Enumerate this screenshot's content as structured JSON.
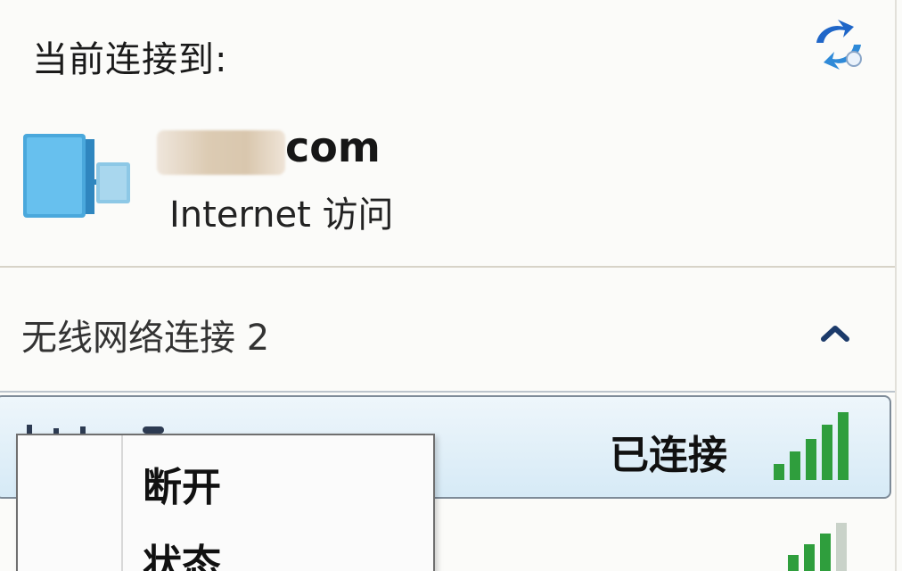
{
  "header": {
    "title": "当前连接到:"
  },
  "current_network": {
    "name_visible_suffix": "com",
    "access": "Internet 访问"
  },
  "wireless_section": {
    "title": "无线网络连接 2"
  },
  "network_list": {
    "selected_status": "已连接"
  },
  "context_menu": {
    "items": [
      {
        "label": "断开"
      },
      {
        "label": "状态"
      }
    ]
  },
  "icons": {
    "refresh": "refresh-icon",
    "network": "network-icon",
    "collapse": "chevron-up-icon",
    "signal": "signal-strength-icon"
  },
  "colors": {
    "accent_blue": "#1f66c8",
    "signal_green": "#2f9e3d",
    "selection_bg": "#d6eaf6"
  }
}
